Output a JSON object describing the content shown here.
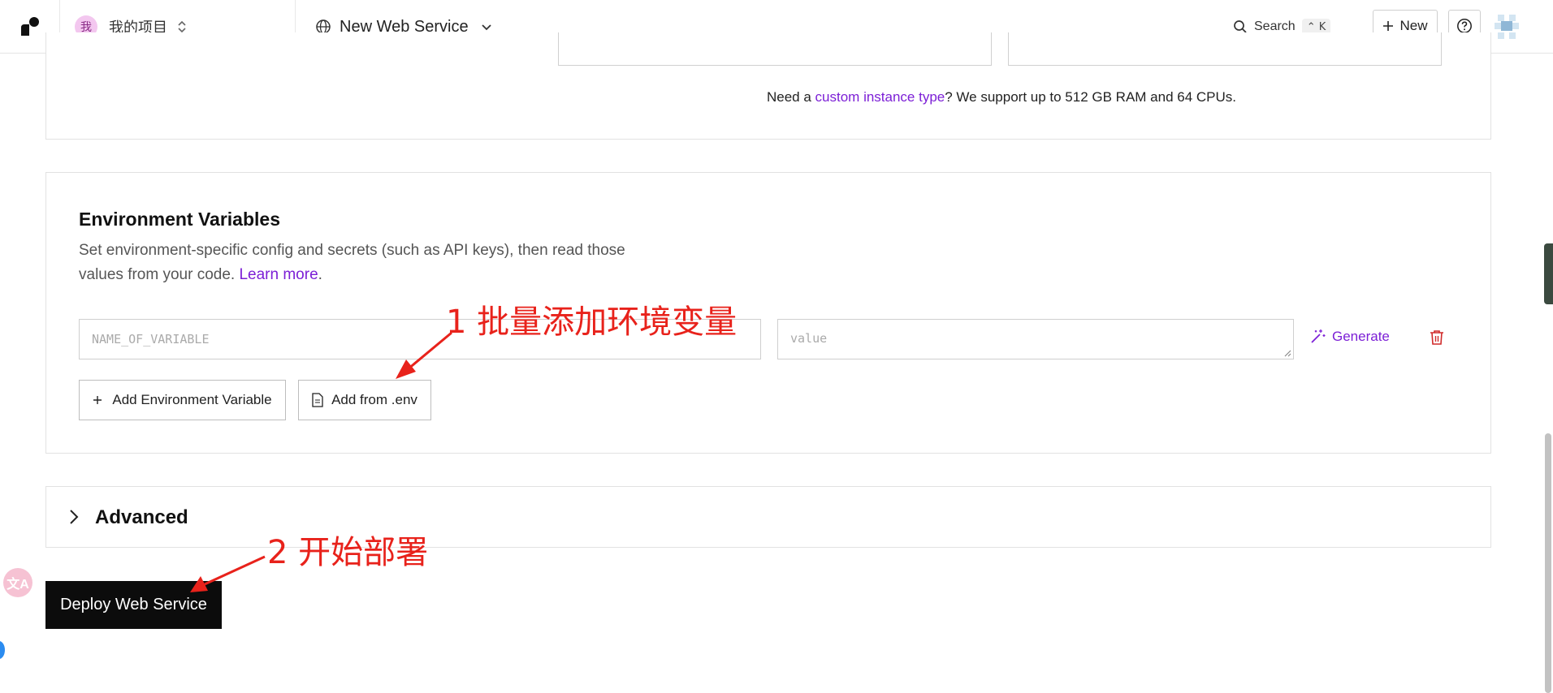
{
  "topbar": {
    "project_avatar": "我",
    "project_name": "我的项目",
    "service_name": "New Web Service",
    "search_label": "Search",
    "search_shortcut": "⌃ K",
    "new_label": "New"
  },
  "instance": {
    "note_prefix": "Need a ",
    "note_link": "custom instance type",
    "note_suffix": "? We support up to 512 GB RAM and 64 CPUs."
  },
  "env": {
    "title": "Environment Variables",
    "description": "Set environment-specific config and secrets (such as API keys), then read those values from your code. ",
    "learn_more": "Learn more",
    "learn_more_suffix": ".",
    "name_placeholder": "NAME_OF_VARIABLE",
    "value_placeholder": "value",
    "generate_label": "Generate",
    "add_env_label": "Add Environment Variable",
    "add_from_env_label": "Add from .env"
  },
  "advanced": {
    "title": "Advanced"
  },
  "deploy": {
    "label": "Deploy Web Service"
  },
  "annotations": {
    "step1": "1 批量添加环境变量",
    "step2": "2 开始部署"
  },
  "colors": {
    "accent": "#7c1fd6",
    "annotation": "#e8221b",
    "deploy_bg": "#0c0c0c"
  }
}
